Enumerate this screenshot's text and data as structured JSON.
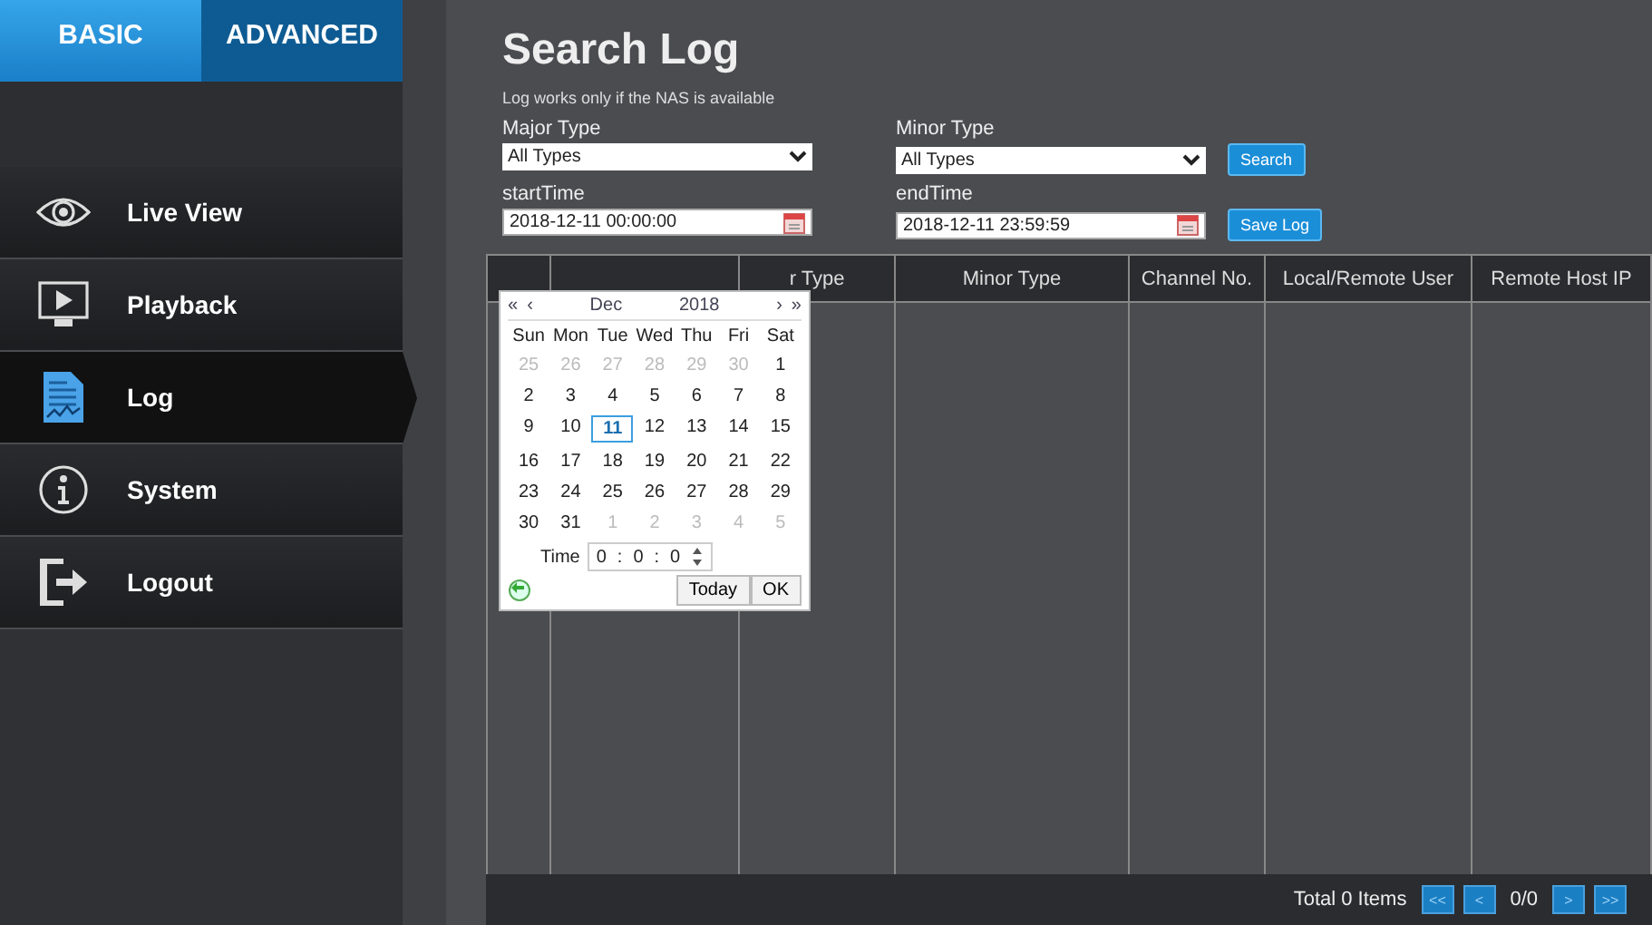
{
  "sidebar": {
    "tabs": [
      {
        "label": "BASIC",
        "selected": true
      },
      {
        "label": "ADVANCED",
        "selected": false
      }
    ],
    "items": [
      {
        "kind": "eye",
        "label": "Live View",
        "selected": false
      },
      {
        "kind": "playback",
        "label": "Playback",
        "selected": false
      },
      {
        "kind": "log",
        "label": "Log",
        "selected": true
      },
      {
        "kind": "info",
        "label": "System",
        "selected": false
      },
      {
        "kind": "logout",
        "label": "Logout",
        "selected": false
      }
    ]
  },
  "page": {
    "title": "Search Log",
    "note": "Log works only if the NAS is available",
    "filters": [
      {
        "label": "Major Type",
        "kind": "select",
        "value": "All Types"
      },
      {
        "label": "Minor Type",
        "kind": "select",
        "value": "All Types"
      },
      {
        "label": "startTime",
        "kind": "date",
        "value": "2018-12-11 00:00:00"
      },
      {
        "label": "endTime",
        "kind": "date",
        "value": "2018-12-11 23:59:59"
      }
    ],
    "buttons": [
      "Search",
      "Save Log"
    ]
  },
  "table": {
    "columns": [
      {},
      {},
      {
        "label": "r Type"
      },
      {
        "label": "Minor Type"
      },
      {
        "label": "Channel No."
      },
      {
        "label": "Local/Remote User"
      },
      {
        "label": "Remote Host IP"
      }
    ],
    "footer": {
      "total": "Total 0 Items",
      "first": "<<",
      "prev": "<",
      "page": "0/0",
      "next": ">",
      "last": ">>"
    }
  },
  "calendar": {
    "nav": [
      "«",
      "‹",
      "›",
      "»"
    ],
    "month": "Dec",
    "year": "2018",
    "weekdays": [
      "Sun",
      "Mon",
      "Tue",
      "Wed",
      "Thu",
      "Fri",
      "Sat"
    ],
    "weeks": [
      [
        {
          "d": "25",
          "outside": true,
          "selected": false
        },
        {
          "d": "26",
          "outside": true,
          "selected": false
        },
        {
          "d": "27",
          "outside": true,
          "selected": false
        },
        {
          "d": "28",
          "outside": true,
          "selected": false
        },
        {
          "d": "29",
          "outside": true,
          "selected": false
        },
        {
          "d": "30",
          "outside": true,
          "selected": false
        },
        {
          "d": "1",
          "outside": false,
          "selected": false
        }
      ],
      [
        {
          "d": "2",
          "outside": false,
          "selected": false
        },
        {
          "d": "3",
          "outside": false,
          "selected": false
        },
        {
          "d": "4",
          "outside": false,
          "selected": false
        },
        {
          "d": "5",
          "outside": false,
          "selected": false
        },
        {
          "d": "6",
          "outside": false,
          "selected": false
        },
        {
          "d": "7",
          "outside": false,
          "selected": false
        },
        {
          "d": "8",
          "outside": false,
          "selected": false
        }
      ],
      [
        {
          "d": "9",
          "outside": false,
          "selected": false
        },
        {
          "d": "10",
          "outside": false,
          "selected": false
        },
        {
          "d": "11",
          "outside": false,
          "selected": true
        },
        {
          "d": "12",
          "outside": false,
          "selected": false
        },
        {
          "d": "13",
          "outside": false,
          "selected": false
        },
        {
          "d": "14",
          "outside": false,
          "selected": false
        },
        {
          "d": "15",
          "outside": false,
          "selected": false
        }
      ],
      [
        {
          "d": "16",
          "outside": false,
          "selected": false
        },
        {
          "d": "17",
          "outside": false,
          "selected": false
        },
        {
          "d": "18",
          "outside": false,
          "selected": false
        },
        {
          "d": "19",
          "outside": false,
          "selected": false
        },
        {
          "d": "20",
          "outside": false,
          "selected": false
        },
        {
          "d": "21",
          "outside": false,
          "selected": false
        },
        {
          "d": "22",
          "outside": false,
          "selected": false
        }
      ],
      [
        {
          "d": "23",
          "outside": false,
          "selected": false
        },
        {
          "d": "24",
          "outside": false,
          "selected": false
        },
        {
          "d": "25",
          "outside": false,
          "selected": false
        },
        {
          "d": "26",
          "outside": false,
          "selected": false
        },
        {
          "d": "27",
          "outside": false,
          "selected": false
        },
        {
          "d": "28",
          "outside": false,
          "selected": false
        },
        {
          "d": "29",
          "outside": false,
          "selected": false
        }
      ],
      [
        {
          "d": "30",
          "outside": false,
          "selected": false
        },
        {
          "d": "31",
          "outside": false,
          "selected": false
        },
        {
          "d": "1",
          "outside": true,
          "selected": false
        },
        {
          "d": "2",
          "outside": true,
          "selected": false
        },
        {
          "d": "3",
          "outside": true,
          "selected": false
        },
        {
          "d": "4",
          "outside": true,
          "selected": false
        },
        {
          "d": "5",
          "outside": true,
          "selected": false
        }
      ]
    ],
    "time_label": "Time",
    "time": [
      "0",
      ":",
      "0",
      ":",
      "0"
    ],
    "buttons": [
      "Today",
      "OK"
    ]
  }
}
